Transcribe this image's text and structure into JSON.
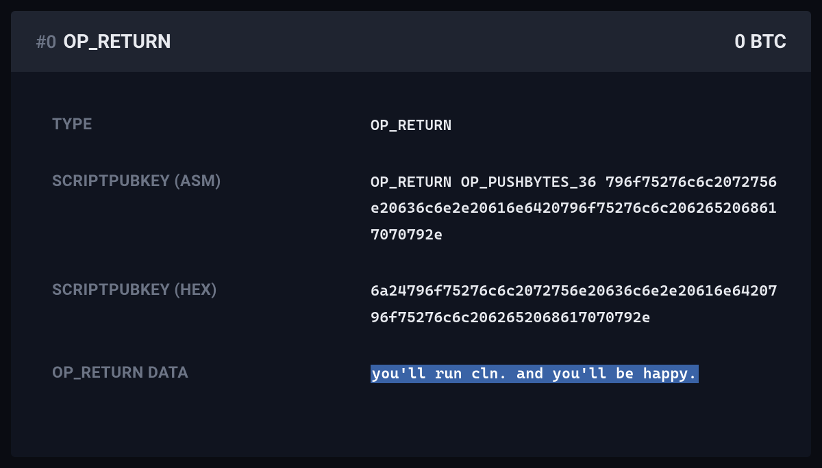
{
  "header": {
    "index": "#0",
    "title": "OP_RETURN",
    "amount": "0 BTC"
  },
  "details": {
    "type": {
      "label": "TYPE",
      "value": "OP_RETURN"
    },
    "scriptpubkey_asm": {
      "label": "SCRIPTPUBKEY (ASM)",
      "value": "OP_RETURN OP_PUSHBYTES_36 796f75276c6c2072756e20636c6e2e20616e6420796f75276c6c2062652068617070792e"
    },
    "scriptpubkey_hex": {
      "label": "SCRIPTPUBKEY (HEX)",
      "value": "6a24796f75276c6c2072756e20636c6e2e20616e6420796f75276c6c2062652068617070792e"
    },
    "op_return_data": {
      "label": "OP_RETURN DATA",
      "value": "you'll run cln. and you'll be happy."
    }
  }
}
